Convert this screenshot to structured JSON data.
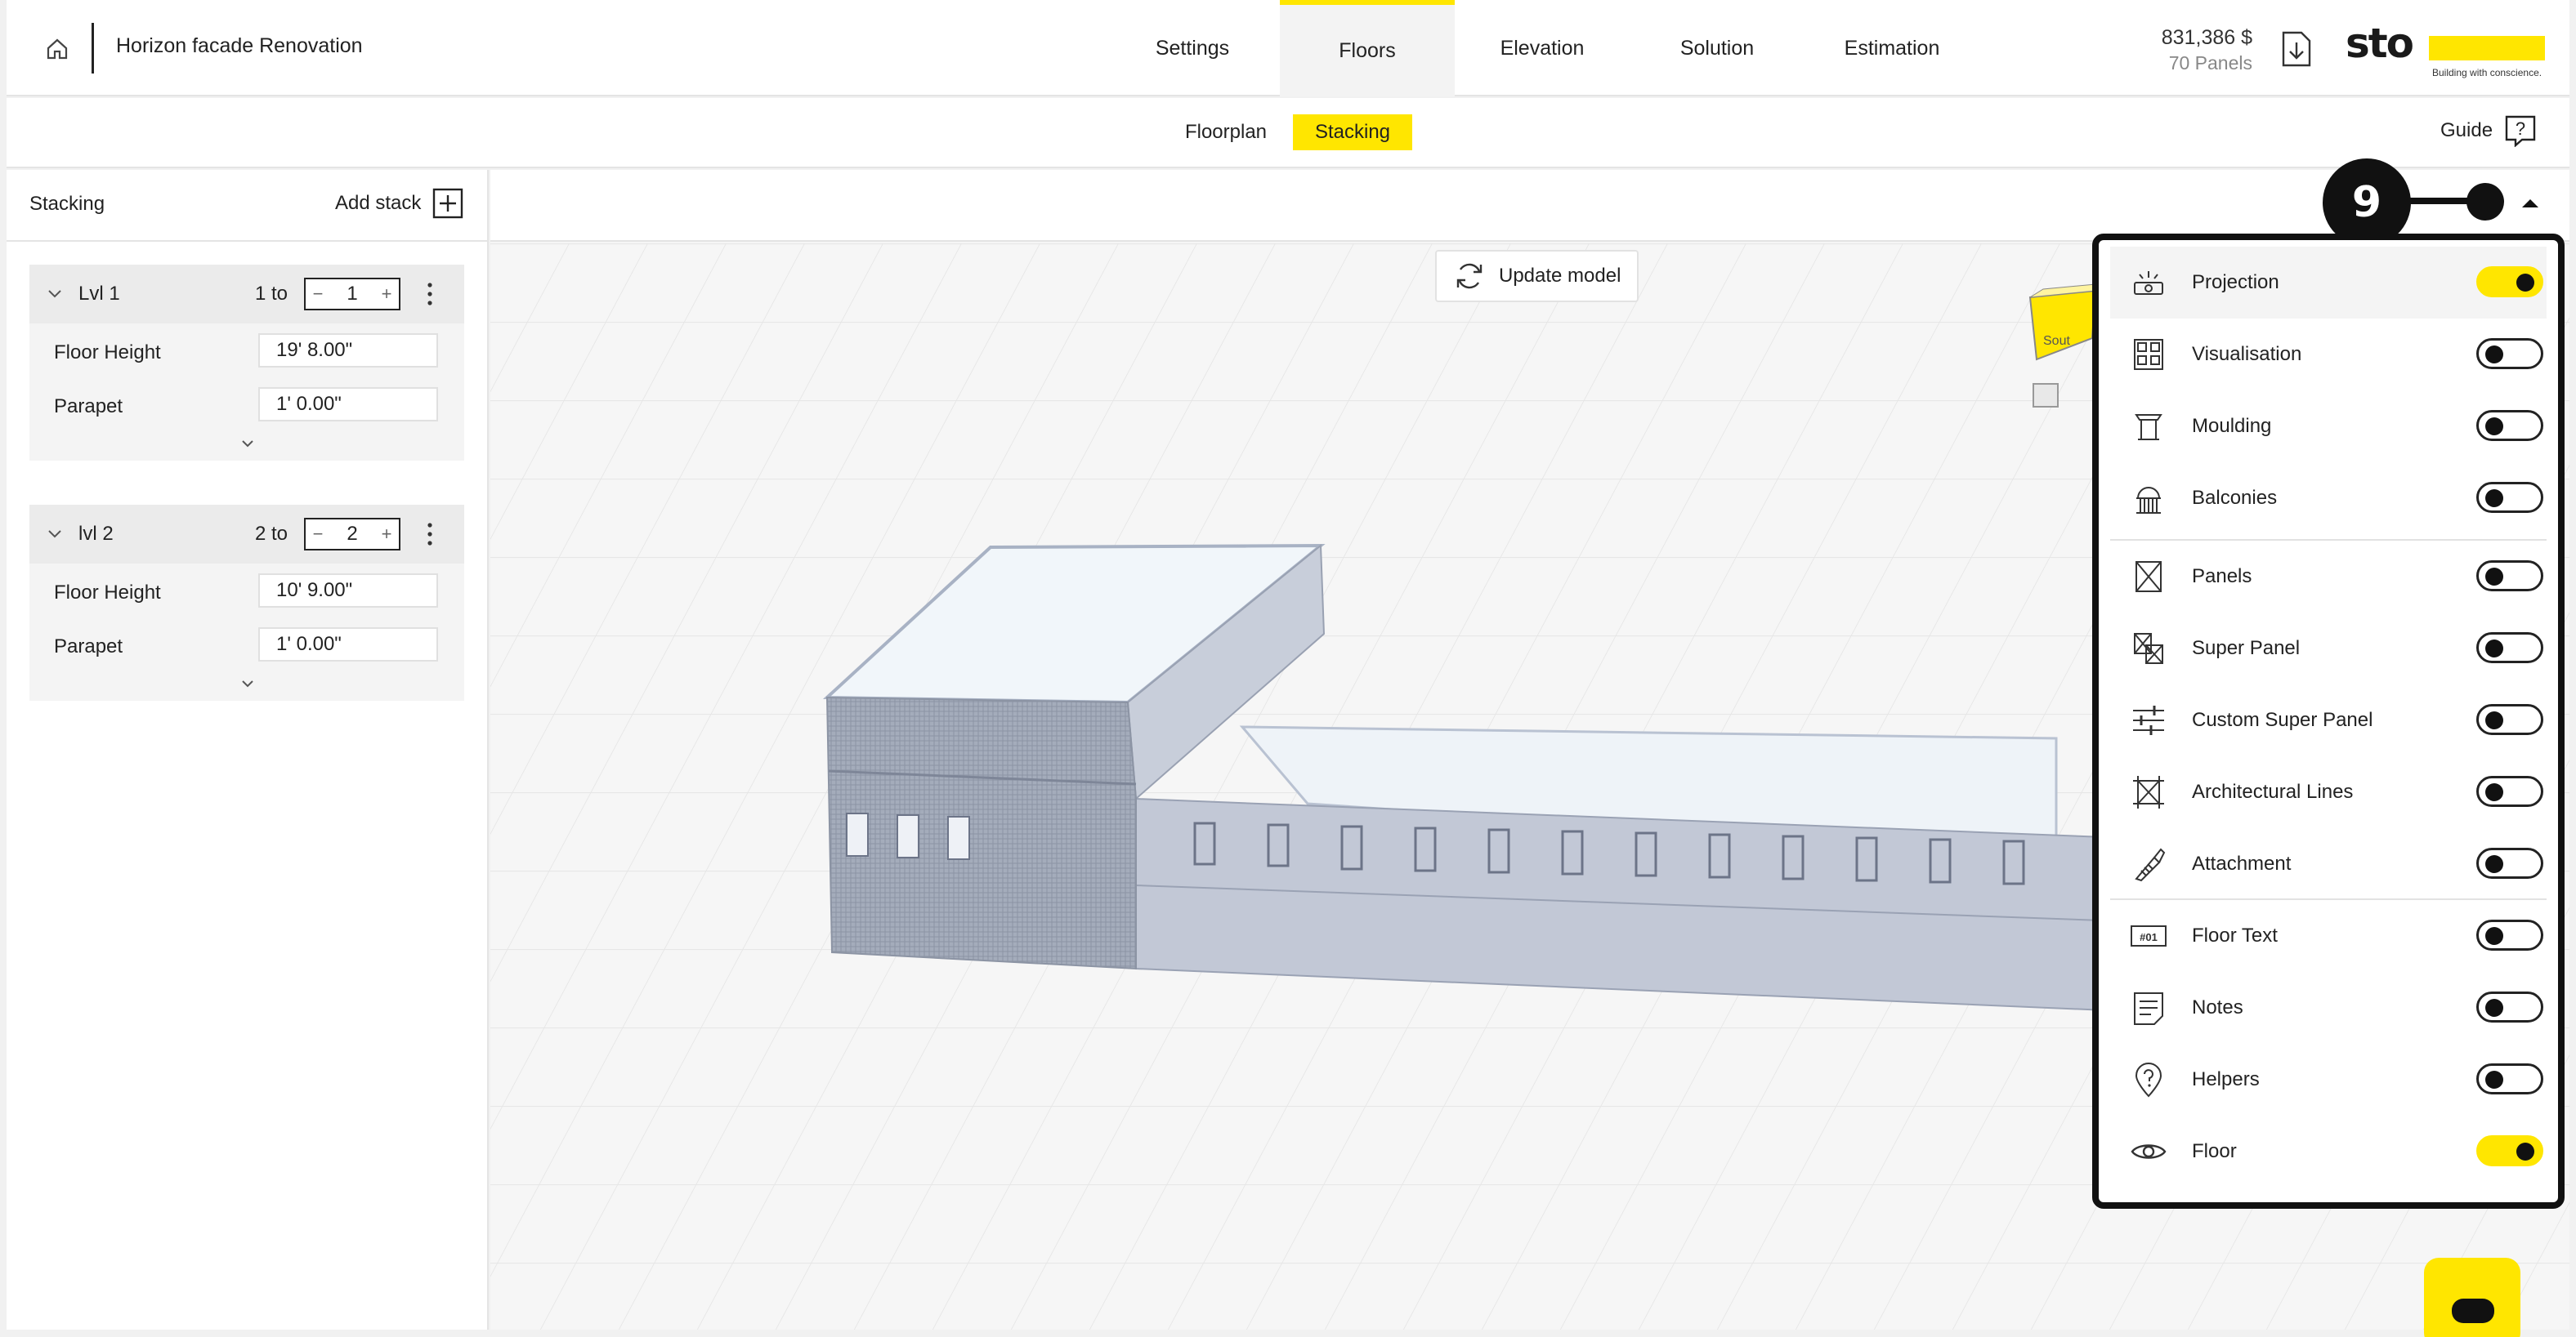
{
  "header": {
    "project_title": "Horizon facade Renovation",
    "tabs": [
      {
        "label": "Settings",
        "active": false
      },
      {
        "label": "Floors",
        "active": true
      },
      {
        "label": "Elevation",
        "active": false
      },
      {
        "label": "Solution",
        "active": false
      },
      {
        "label": "Estimation",
        "active": false
      }
    ],
    "price": "831,386 $",
    "panels": "70 Panels",
    "brand_logo": "sto",
    "brand_tagline": "Building with conscience.",
    "accent_color": "#ffe600"
  },
  "subnav": {
    "tabs": [
      {
        "label": "Floorplan",
        "active": false
      },
      {
        "label": "Stacking",
        "active": true
      }
    ],
    "guide_label": "Guide",
    "guide_icon": "?"
  },
  "stacking": {
    "title": "Stacking",
    "add_label": "Add stack",
    "levels": [
      {
        "name": "Lvl 1",
        "range_prefix": "1 to",
        "value": "1",
        "floor_height_label": "Floor Height",
        "floor_height": "19' 8.00\"",
        "parapet_label": "Parapet",
        "parapet": "1' 0.00\""
      },
      {
        "name": "lvl 2",
        "range_prefix": "2 to",
        "value": "2",
        "floor_height_label": "Floor Height",
        "floor_height": "10' 9.00\"",
        "parapet_label": "Parapet",
        "parapet": "1' 0.00\""
      }
    ]
  },
  "viewport": {
    "update_label": "Update model",
    "compass_label": "Sout"
  },
  "marker": {
    "number": "9"
  },
  "layers": {
    "items": [
      {
        "label": "Projection",
        "icon": "projection-icon",
        "on": true
      },
      {
        "label": "Visualisation",
        "icon": "visualisation-icon",
        "on": false
      },
      {
        "label": "Moulding",
        "icon": "moulding-icon",
        "on": false
      },
      {
        "label": "Balconies",
        "icon": "balconies-icon",
        "on": false
      },
      {
        "label": "Panels",
        "icon": "panels-icon",
        "on": false
      },
      {
        "label": "Super Panel",
        "icon": "super-panel-icon",
        "on": false
      },
      {
        "label": "Custom Super Panel",
        "icon": "custom-super-panel-icon",
        "on": false
      },
      {
        "label": "Architectural Lines",
        "icon": "architectural-lines-icon",
        "on": false
      },
      {
        "label": "Attachment",
        "icon": "attachment-icon",
        "on": false
      },
      {
        "label": "Floor Text",
        "icon": "floor-text-icon",
        "on": false
      },
      {
        "label": "Notes",
        "icon": "notes-icon",
        "on": false
      },
      {
        "label": "Helpers",
        "icon": "helpers-icon",
        "on": false
      },
      {
        "label": "Floor",
        "icon": "eye-icon",
        "on": true
      }
    ],
    "floor_text_badge": "#01"
  }
}
